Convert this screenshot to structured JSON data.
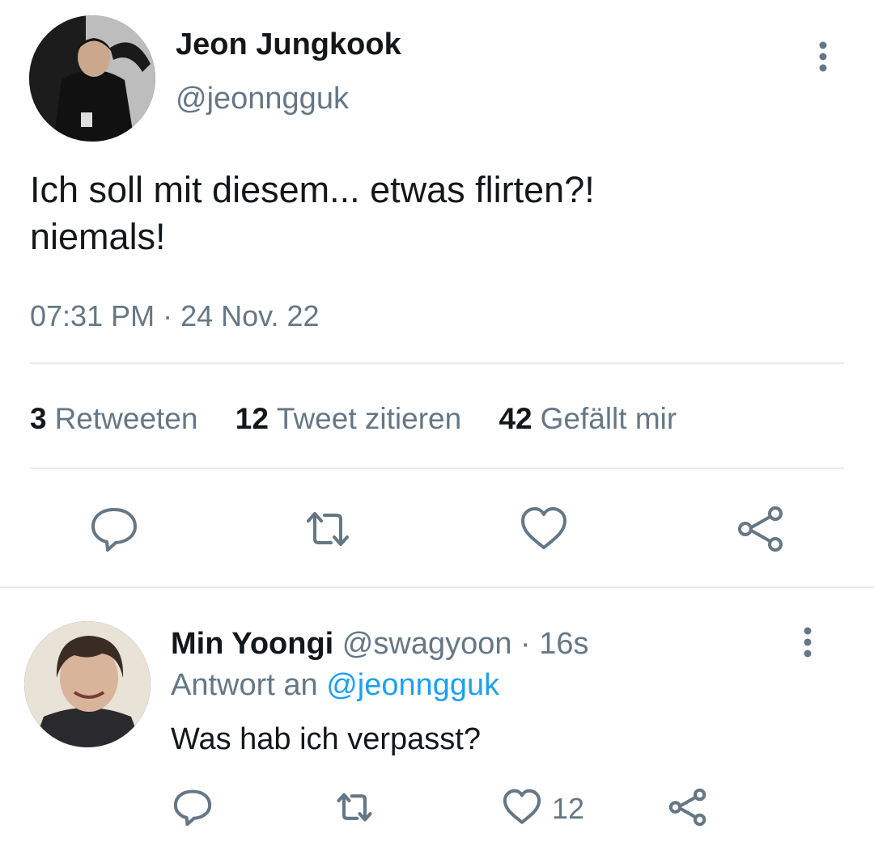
{
  "main_tweet": {
    "name": "Jeon Jungkook",
    "handle": "@jeonngguk",
    "text_line1": "Ich soll mit diesem... etwas flirten?!",
    "text_line2": "niemals!",
    "timestamp": "07:31 PM · 24 Nov. 22",
    "stats": [
      {
        "count": "3",
        "label": "Retweeten"
      },
      {
        "count": "12",
        "label": "Tweet zitieren"
      },
      {
        "count": "42",
        "label": "Gefällt mir"
      }
    ],
    "actions": [
      "reply-icon",
      "retweet-icon",
      "like-icon",
      "share-icon"
    ]
  },
  "reply_tweet": {
    "name": "Min Yoongi",
    "handle": "@swagyoon",
    "separator": "·",
    "time": "16s",
    "reply_to_prefix": "Antwort an",
    "reply_to_handle": "@jeonngguk",
    "text": "Was hab ich verpasst?",
    "like_count": "12",
    "actions": [
      "reply-icon",
      "retweet-icon",
      "like-icon",
      "share-icon"
    ]
  },
  "colors": {
    "text_primary": "#14171a",
    "text_secondary": "#657786",
    "link": "#1da1f2",
    "divider": "#e6ecf0"
  }
}
